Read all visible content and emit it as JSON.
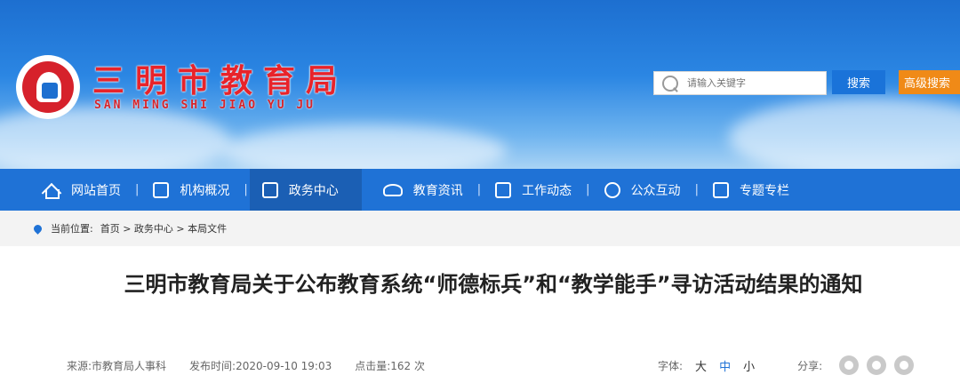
{
  "header": {
    "title": "三明市教育局",
    "subtitle": "SAN MING SHI JIAO YU JU",
    "search_placeholder": "请输入关键字",
    "search_button": "搜索",
    "advanced_search_button": "高级搜索",
    "logo_icon": "sanming-education-logo-icon"
  },
  "nav": {
    "items": [
      {
        "label": "网站首页",
        "icon": "home-icon"
      },
      {
        "label": "机构概况",
        "icon": "building-icon"
      },
      {
        "label": "政务中心",
        "icon": "monitor-icon",
        "active": true
      },
      {
        "label": "教育资讯",
        "icon": "graduation-cap-icon"
      },
      {
        "label": "工作动态",
        "icon": "newspaper-icon"
      },
      {
        "label": "公众互动",
        "icon": "chat-icon"
      },
      {
        "label": "专题专栏",
        "icon": "flag-icon"
      }
    ],
    "separator": "|"
  },
  "breadcrumb": {
    "label": "当前位置:",
    "path": "首页 > 政务中心 > 本局文件"
  },
  "article": {
    "title": "三明市教育局关于公布教育系统“师德标兵”和“教学能手”寻访活动结果的通知",
    "source": "来源:市教育局人事科",
    "publish_time": "发布时间:2020-09-10 19:03",
    "clicks": "点击量:162 次"
  },
  "tools": {
    "font_label": "字体:",
    "font_large": "大",
    "font_medium": "中",
    "font_small": "小",
    "share_label": "分享:"
  },
  "colors": {
    "nav_blue": "#1f72d6",
    "active_nav": "#1b5fb4",
    "title_red": "#e8232a",
    "advanced_orange": "#f08a17"
  }
}
